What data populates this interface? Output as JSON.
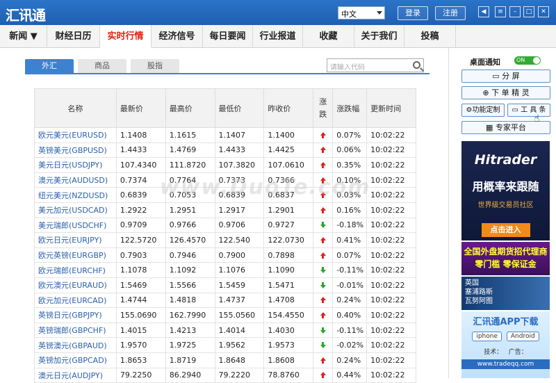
{
  "app": {
    "title": "汇讯通"
  },
  "titlebar": {
    "language": "中文",
    "login_label": "登录",
    "register_label": "注册",
    "window_buttons": [
      "volume-icon",
      "menu-icon",
      "minimize-icon",
      "maximize-icon",
      "close-icon"
    ]
  },
  "nav": {
    "items": [
      "新闻 ▼",
      "财经日历",
      "实时行情",
      "经济信号",
      "每日要闻",
      "行业报道",
      "收藏",
      "关于我们",
      "投稿"
    ],
    "active": "实时行情"
  },
  "market": {
    "tabs": [
      "外汇",
      "商品",
      "股指"
    ],
    "active_tab": "外汇",
    "search_placeholder": "请输入代码",
    "columns": [
      "名称",
      "最新价",
      "最高价",
      "最低价",
      "昨收价",
      "涨跌",
      "涨跌幅",
      "更新时间"
    ],
    "rows": [
      {
        "name": "欧元美元(EURUSD)",
        "last": "1.1408",
        "high": "1.1615",
        "low": "1.1407",
        "prev": "1.1400",
        "dir": "up",
        "pct": "0.07%",
        "time": "10:02:22"
      },
      {
        "name": "英镑美元(GBPUSD)",
        "last": "1.4433",
        "high": "1.4769",
        "low": "1.4433",
        "prev": "1.4425",
        "dir": "up",
        "pct": "0.06%",
        "time": "10:02:22"
      },
      {
        "name": "美元日元(USDJPY)",
        "last": "107.4340",
        "high": "111.8720",
        "low": "107.3820",
        "prev": "107.0610",
        "dir": "up",
        "pct": "0.35%",
        "time": "10:02:22"
      },
      {
        "name": "澳元美元(AUDUSD)",
        "last": "0.7374",
        "high": "0.7764",
        "low": "0.7373",
        "prev": "0.7366",
        "dir": "up",
        "pct": "0.10%",
        "time": "10:02:22"
      },
      {
        "name": "纽元美元(NZDUSD)",
        "last": "0.6839",
        "high": "0.7053",
        "low": "0.6839",
        "prev": "0.6837",
        "dir": "up",
        "pct": "0.03%",
        "time": "10:02:22"
      },
      {
        "name": "美元加元(USDCAD)",
        "last": "1.2922",
        "high": "1.2951",
        "low": "1.2917",
        "prev": "1.2901",
        "dir": "up",
        "pct": "0.16%",
        "time": "10:02:22"
      },
      {
        "name": "美元瑞郎(USDCHF)",
        "last": "0.9709",
        "high": "0.9766",
        "low": "0.9706",
        "prev": "0.9727",
        "dir": "down",
        "pct": "-0.18%",
        "time": "10:02:22"
      },
      {
        "name": "欧元日元(EURJPY)",
        "last": "122.5720",
        "high": "126.4570",
        "low": "122.540",
        "prev": "122.0730",
        "dir": "up",
        "pct": "0.41%",
        "time": "10:02:22"
      },
      {
        "name": "欧元英镑(EURGBP)",
        "last": "0.7903",
        "high": "0.7946",
        "low": "0.7900",
        "prev": "0.7898",
        "dir": "up",
        "pct": "0.07%",
        "time": "10:02:22"
      },
      {
        "name": "欧元瑞郎(EURCHF)",
        "last": "1.1078",
        "high": "1.1092",
        "low": "1.1076",
        "prev": "1.1090",
        "dir": "down",
        "pct": "-0.11%",
        "time": "10:02:22"
      },
      {
        "name": "欧元澳元(EURAUD)",
        "last": "1.5469",
        "high": "1.5566",
        "low": "1.5459",
        "prev": "1.5471",
        "dir": "down",
        "pct": "-0.01%",
        "time": "10:02:22"
      },
      {
        "name": "欧元加元(EURCAD)",
        "last": "1.4744",
        "high": "1.4818",
        "low": "1.4737",
        "prev": "1.4708",
        "dir": "up",
        "pct": "0.24%",
        "time": "10:02:22"
      },
      {
        "name": "英镑日元(GBPJPY)",
        "last": "155.0690",
        "high": "162.7990",
        "low": "155.0560",
        "prev": "154.4550",
        "dir": "up",
        "pct": "0.40%",
        "time": "10:02:22"
      },
      {
        "name": "英镑瑞郎(GBPCHF)",
        "last": "1.4015",
        "high": "1.4213",
        "low": "1.4014",
        "prev": "1.4030",
        "dir": "down",
        "pct": "-0.11%",
        "time": "10:02:22"
      },
      {
        "name": "英镑澳元(GBPAUD)",
        "last": "1.9570",
        "high": "1.9725",
        "low": "1.9562",
        "prev": "1.9573",
        "dir": "down",
        "pct": "-0.02%",
        "time": "10:02:22"
      },
      {
        "name": "英镑加元(GBPCAD)",
        "last": "1.8653",
        "high": "1.8719",
        "low": "1.8648",
        "prev": "1.8608",
        "dir": "up",
        "pct": "0.24%",
        "time": "10:02:22"
      },
      {
        "name": "澳元日元(AUDJPY)",
        "last": "79.2250",
        "high": "86.2940",
        "low": "79.2220",
        "prev": "78.8760",
        "dir": "up",
        "pct": "0.44%",
        "time": "10:02:22"
      }
    ],
    "colors": {
      "up": "#e02020",
      "down": "#2aa32a",
      "accent": "#3d82d1"
    }
  },
  "watermark": "www.DuoTe.com",
  "sidebar": {
    "notify_label": "桌面通知",
    "toggle_label": "ON",
    "buttons": [
      {
        "label": "分 屏",
        "icon": "split-screen-icon"
      },
      {
        "label": "下 单 精 灵",
        "icon": "order-icon"
      },
      {
        "label": "功能定制",
        "icon": "gear-icon"
      },
      {
        "label": "工 具 条",
        "icon": "toolbar-icon"
      },
      {
        "label": "专家平台",
        "icon": "grid-icon"
      }
    ],
    "ad1": {
      "brand": "Hitrader",
      "headline": "用概率来跟随",
      "sub": "世界级交易员社区",
      "cta": "点击进入"
    },
    "ad2": {
      "line1": "全国外盘期货招代理商",
      "line2": "零门槛 零保证金"
    },
    "ad3": {
      "line1": "英国",
      "line2": "塞浦路斯",
      "line3": "瓦努阿图"
    },
    "ad4": {
      "title": "汇讯通APP下载",
      "iphone": "iphone",
      "android": "Android",
      "qq1": "技术：",
      "qq2": "广告：",
      "url": "www.tradeqq.com"
    }
  }
}
